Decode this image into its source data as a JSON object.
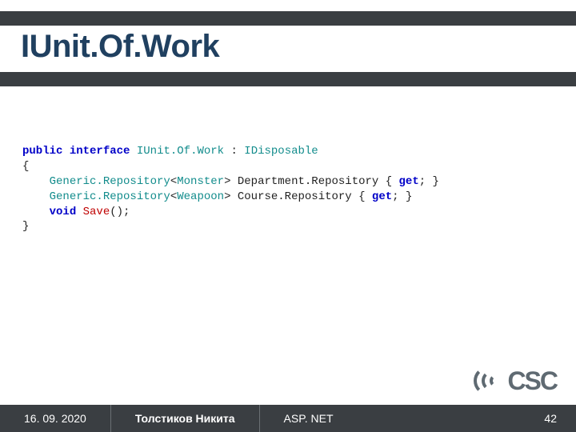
{
  "title": "IUnit.Of.Work",
  "code": {
    "l1": {
      "kw1": "public",
      "kw2": "interface",
      "type1": "IUnit.Of.Work",
      "punc1": " : ",
      "type2": "IDisposable"
    },
    "l2": "{",
    "l3": {
      "indent": "    ",
      "type1": "Generic.Repository",
      "lt": "<",
      "type2": "Monster",
      "gt": "> ",
      "name": "Department.Repository",
      "open": " { ",
      "kw1": "get",
      "semi": "; }"
    },
    "l4": {
      "indent": "    ",
      "type1": "Generic.Repository",
      "lt": "<",
      "type2": "Weapoon",
      "gt": "> ",
      "name": "Course.Repository",
      "open": " { ",
      "kw1": "get",
      "semi": "; }"
    },
    "l5": {
      "indent": "    ",
      "kw1": "void",
      "sp": " ",
      "method": "Save",
      "paren": "();"
    },
    "l6": "}"
  },
  "footer": {
    "date": "16. 09. 2020",
    "author": "Толстиков Никита",
    "topic": "ASP. NET",
    "page": "42"
  },
  "logo_text": "CSC"
}
